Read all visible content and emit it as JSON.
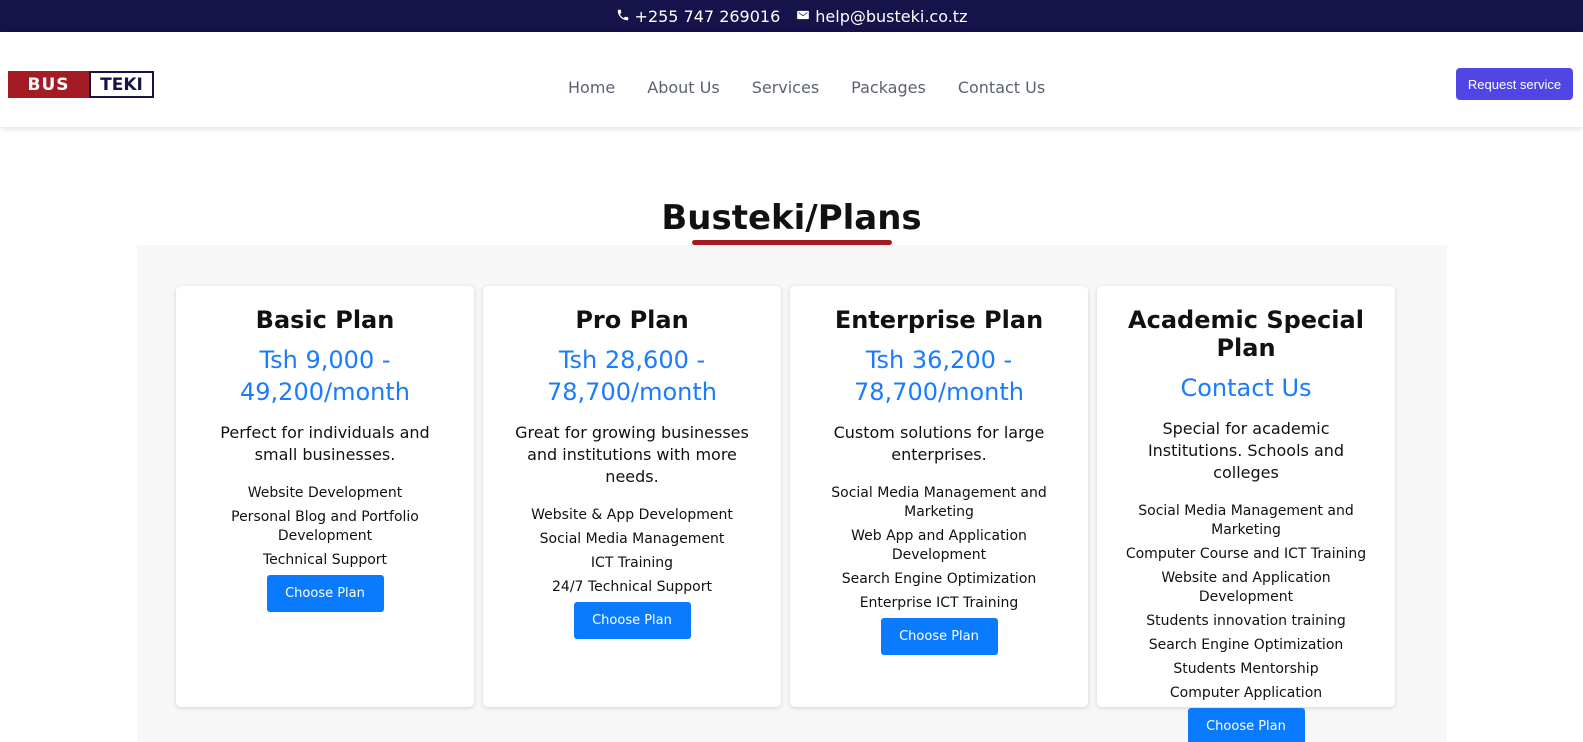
{
  "topbar": {
    "phone": "+255 747 269016",
    "email": "help@busteki.co.tz",
    "phone_icon": "phone-icon",
    "email_icon": "envelope-icon"
  },
  "header": {
    "logo": {
      "part1": "BUS",
      "part2": "TEKI"
    },
    "nav": [
      "Home",
      "About Us",
      "Services",
      "Packages",
      "Contact Us"
    ],
    "request_button": "Request service"
  },
  "section": {
    "title": "Busteki/Plans"
  },
  "plans": [
    {
      "name": "Basic Plan",
      "price": "Tsh 9,000 - 49,200/month",
      "description": "Perfect for individuals and small businesses.",
      "features": [
        "Website Development",
        "Personal Blog and Portfolio Development",
        "Technical Support"
      ],
      "button": "Choose Plan"
    },
    {
      "name": "Pro Plan",
      "price": "Tsh 28,600 - 78,700/month",
      "description": "Great for growing businesses and institutions with more needs.",
      "features": [
        "Website & App Development",
        "Social Media Management",
        "ICT Training",
        "24/7 Technical Support"
      ],
      "button": "Choose Plan"
    },
    {
      "name": "Enterprise Plan",
      "price": "Tsh 36,200 - 78,700/month",
      "description": "Custom solutions for large enterprises.",
      "features": [
        "Social Media Management and Marketing",
        "Web App and Application Development",
        "Search Engine Optimization",
        "Enterprise ICT Training"
      ],
      "button": "Choose Plan"
    },
    {
      "name": "Academic Special Plan",
      "price": "Contact Us",
      "description": "Special for academic Institutions. Schools and colleges",
      "features": [
        "Social Media Management and Marketing",
        "Computer Course and ICT Training",
        "Website and Application Development",
        "Students innovation training",
        "Search Engine Optimization",
        "Students Mentorship",
        "Computer Application"
      ],
      "button": "Choose Plan"
    }
  ],
  "colors": {
    "topbar": "#16124a",
    "brand_red": "#a51b24",
    "accent_blue": "#1a7bff",
    "request_purple": "#5046e5"
  }
}
